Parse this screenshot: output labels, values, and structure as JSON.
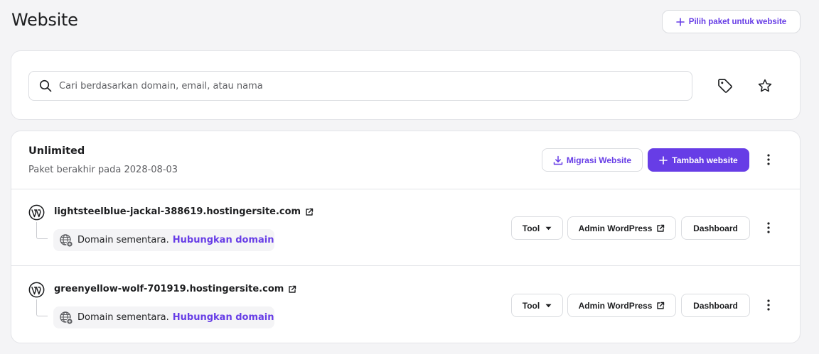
{
  "page": {
    "title": "Website"
  },
  "header": {
    "choose_plan_label": "Pilih paket untuk website"
  },
  "search": {
    "placeholder": "Cari berdasarkan domain, email, atau nama",
    "value": ""
  },
  "plan": {
    "name": "Unlimited",
    "expiry": "Paket berakhir pada 2028-08-03",
    "migrate_label": "Migrasi Website",
    "add_label": "Tambah website"
  },
  "sites": [
    {
      "domain": "lightsteelblue-jackal-388619.hostingersite.com",
      "temp_label": "Domain sementara.",
      "connect_label": "Hubungkan domain",
      "tool_label": "Tool",
      "admin_label": "Admin WordPress",
      "dashboard_label": "Dashboard"
    },
    {
      "domain": "greenyellow-wolf-701919.hostingersite.com",
      "temp_label": "Domain sementara.",
      "connect_label": "Hubungkan domain",
      "tool_label": "Tool",
      "admin_label": "Admin WordPress",
      "dashboard_label": "Dashboard"
    }
  ],
  "colors": {
    "accent": "#673de6",
    "text": "#1d1e20",
    "muted": "#5e5f63",
    "background": "#f4f4f6"
  },
  "icons": [
    "plus-icon",
    "search-icon",
    "tag-icon",
    "star-icon",
    "download-icon",
    "kebab-icon",
    "wordpress-icon",
    "external-link-icon",
    "globe-icon",
    "chevron-down-icon"
  ]
}
